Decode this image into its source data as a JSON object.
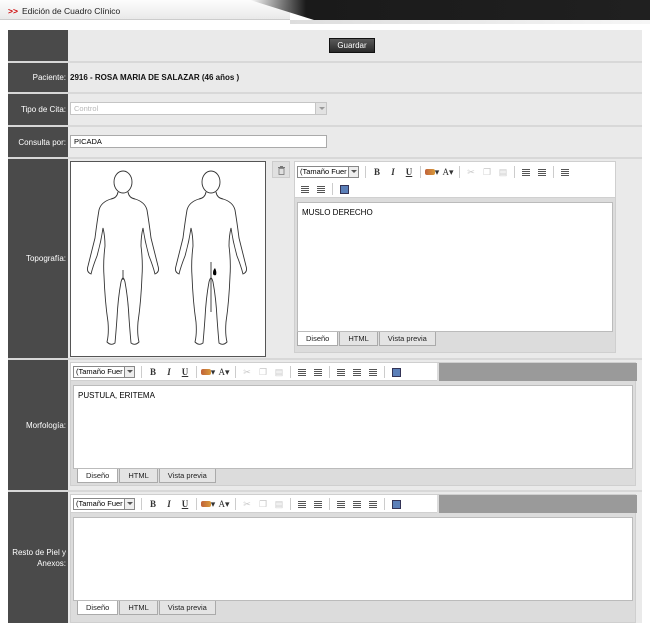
{
  "header": {
    "arrows": ">>",
    "title": "Edición de Cuadro Clínico"
  },
  "actions": {
    "save_label": "Guardar"
  },
  "form": {
    "paciente_label": "Paciente:",
    "paciente_value": "2916  - ROSA MARIA DE SALAZAR  (46 años )",
    "tipo_cita_label": "Tipo de Cita:",
    "tipo_cita_value": "Control",
    "consulta_label": "Consulta por:",
    "consulta_value": "PICADA",
    "topografia_label": "Topografía:",
    "morfologia_label": "Morfología:",
    "resto_label": "Resto de Piel y Anexos:"
  },
  "editor_common": {
    "font_size_placeholder": "(Tamaño Fuer",
    "tab_design": "Diseño",
    "tab_html": "HTML",
    "tab_preview": "Vista previa"
  },
  "editors": {
    "topografia_text": "MUSLO DERECHO",
    "morfologia_text": "PUSTULA, ERITEMA",
    "resto_text": ""
  }
}
